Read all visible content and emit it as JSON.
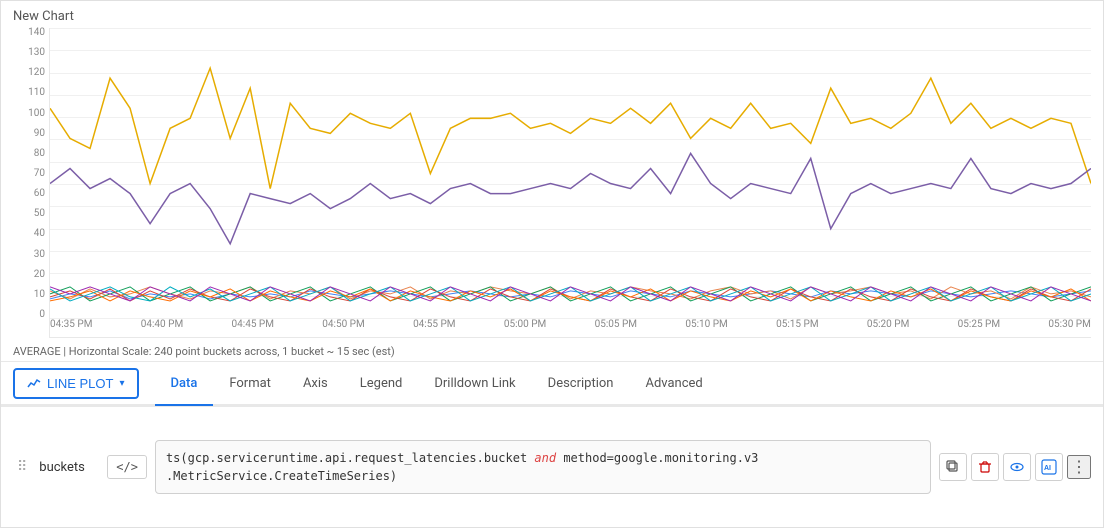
{
  "chart": {
    "title": "New Chart",
    "yAxis": {
      "labels": [
        "140",
        "130",
        "120",
        "110",
        "100",
        "90",
        "80",
        "70",
        "60",
        "50",
        "40",
        "30",
        "20",
        "10",
        "0"
      ]
    },
    "xAxis": {
      "labels": [
        "04:35 PM",
        "04:40 PM",
        "04:45 PM",
        "04:50 PM",
        "04:55 PM",
        "05:00 PM",
        "05:05 PM",
        "05:10 PM",
        "05:15 PM",
        "05:20 PM",
        "05:25 PM",
        "05:30 PM"
      ]
    }
  },
  "statusBar": {
    "text": "AVERAGE  |  Horizontal Scale: 240 point buckets across, 1 bucket ~ 15 sec (est)"
  },
  "tabs": {
    "chartTypeLabel": "LINE PLOT",
    "items": [
      {
        "id": "data",
        "label": "Data",
        "active": true
      },
      {
        "id": "format",
        "label": "Format",
        "active": false
      },
      {
        "id": "axis",
        "label": "Axis",
        "active": false
      },
      {
        "id": "legend",
        "label": "Legend",
        "active": false
      },
      {
        "id": "drilldown",
        "label": "Drilldown Link",
        "active": false
      },
      {
        "id": "description",
        "label": "Description",
        "active": false
      },
      {
        "id": "advanced",
        "label": "Advanced",
        "active": false
      }
    ]
  },
  "dataRow": {
    "fieldName": "buckets",
    "codeBtnLabel": "</>",
    "queryLine1": "ts(gcp.serviceruntime.api.request_latencies.bucket",
    "queryAnd": "and",
    "queryLine2": "method=google.monitoring.v3",
    "queryLine3": ".MetricService.CreateTimeSeries)",
    "actions": {
      "copy": "⧉",
      "delete": "🗑",
      "eye": "👁",
      "ai": "AI",
      "more": "⋮"
    }
  }
}
